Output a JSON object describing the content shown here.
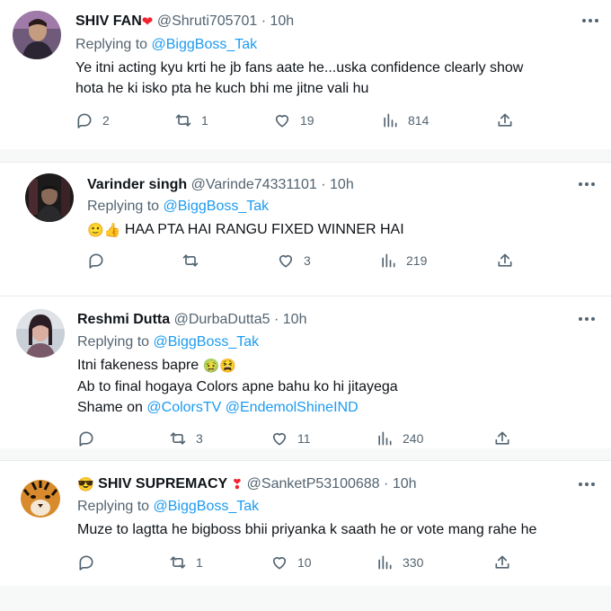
{
  "tweets": [
    {
      "name": "SHIV FAN",
      "name_emoji": "❤",
      "handle": "@Shruti705701",
      "time": "10h",
      "replying_prefix": "Replying to",
      "replying_to": "@BiggBoss_Tak",
      "lines": [
        "Ye itni acting kyu krti he jb fans aate he...uska confidence clearly show",
        "hota he ki isko pta he kuch bhi me jitne vali hu"
      ],
      "replies": "2",
      "retweets": "1",
      "likes": "19",
      "views": "814"
    },
    {
      "name": "Varinder singh",
      "handle": "@Varinde74331101",
      "time": "10h",
      "replying_prefix": "Replying to",
      "replying_to": "@BiggBoss_Tak",
      "emoji_prefix": "🙂👍",
      "lines": [
        "HAA PTA HAI RANGU FIXED WINNER HAI"
      ],
      "replies": "",
      "retweets": "",
      "likes": "3",
      "views": "219"
    },
    {
      "name": "Reshmi Dutta",
      "handle": "@DurbaDutta5",
      "time": "10h",
      "replying_prefix": "Replying to",
      "replying_to": "@BiggBoss_Tak",
      "line1": "Itni fakeness bapre",
      "line1_emoji": "🤢😫",
      "line2": "Ab to final hogaya Colors apne bahu ko hi jitayega",
      "line3_prefix": "Shame on",
      "mention1": "@ColorsTV",
      "mention2": "@EndemolShineIND",
      "replies": "",
      "retweets": "3",
      "likes": "11",
      "views": "240"
    },
    {
      "name_prefix_emoji": "😎",
      "name": "SHIV SUPREMACY",
      "name_emoji": "❣",
      "handle": "@SanketP53100688",
      "time": "10h",
      "replying_prefix": "Replying to",
      "replying_to": "@BiggBoss_Tak",
      "lines": [
        "Muze to lagtta he bigboss bhii priyanka k saath he or vote mang rahe he"
      ],
      "replies": "",
      "retweets": "1",
      "likes": "10",
      "views": "330"
    }
  ],
  "colors": {
    "link": "#1d9bf0",
    "meta": "#536471",
    "heart": "#f4212e"
  }
}
